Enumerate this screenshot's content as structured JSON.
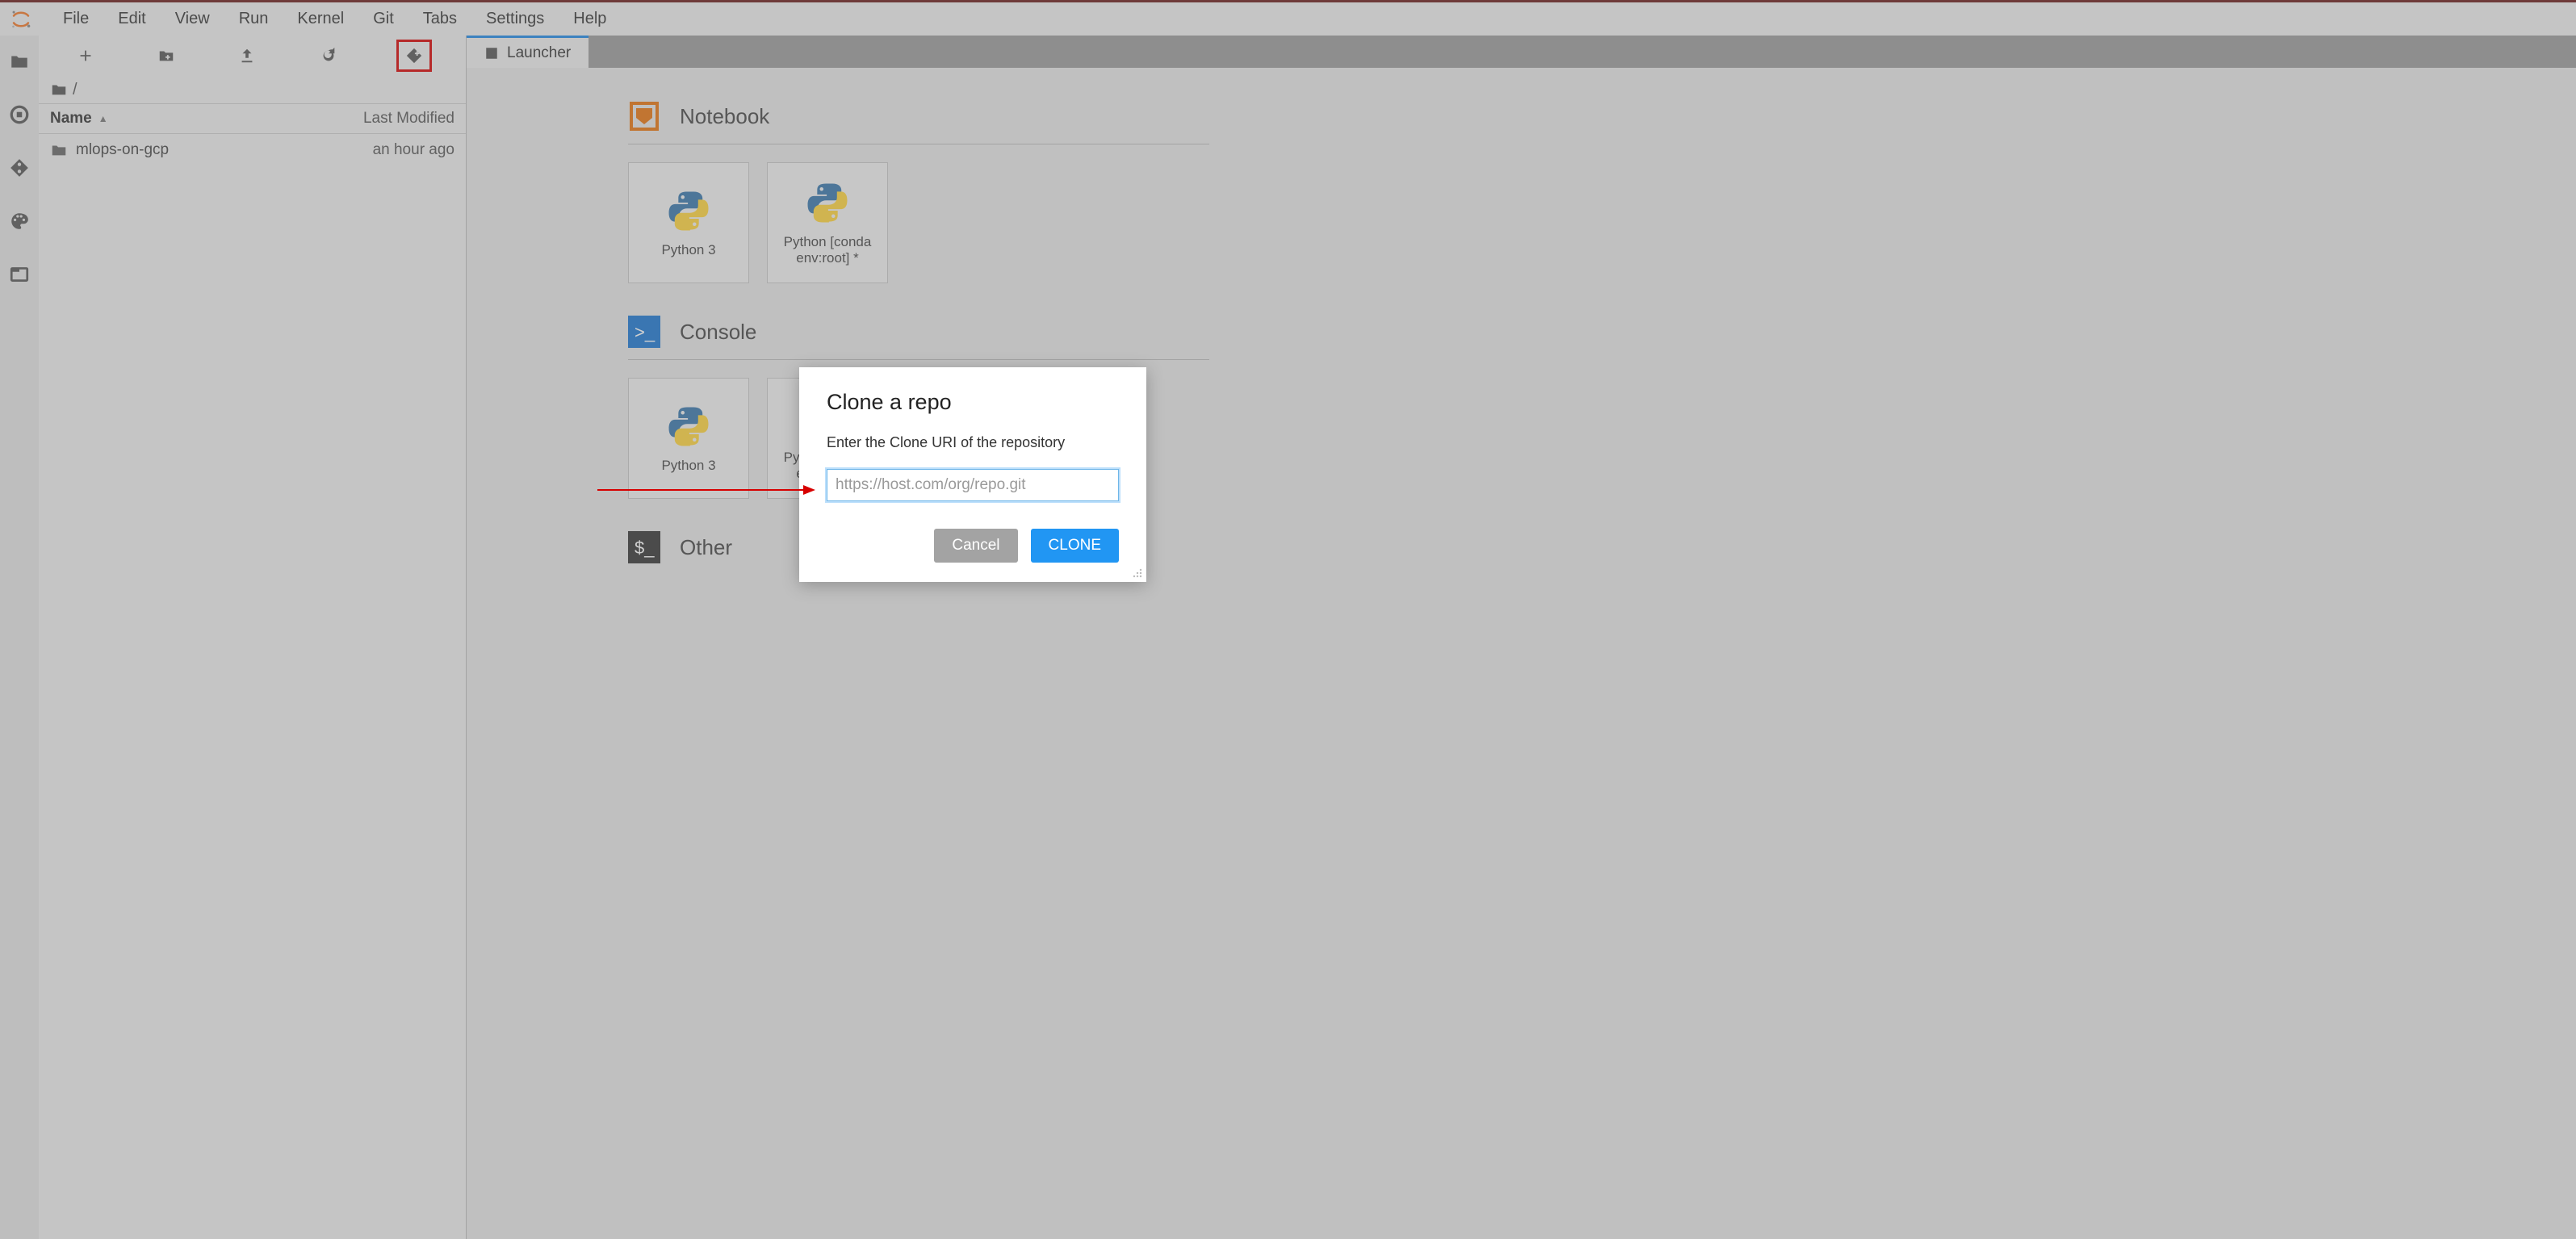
{
  "menu": {
    "items": [
      "File",
      "Edit",
      "View",
      "Run",
      "Kernel",
      "Git",
      "Tabs",
      "Settings",
      "Help"
    ]
  },
  "filebrowser": {
    "breadcrumb_root": "/",
    "columns": {
      "name": "Name",
      "modified": "Last Modified"
    },
    "rows": [
      {
        "name": "mlops-on-gcp",
        "modified": "an hour ago"
      }
    ]
  },
  "tab": {
    "label": "Launcher"
  },
  "launcher": {
    "sections": [
      {
        "title": "Notebook",
        "cards": [
          {
            "label": "Python 3"
          },
          {
            "label": "Python [conda env:root] *"
          }
        ]
      },
      {
        "title": "Console",
        "cards": [
          {
            "label": "Python 3"
          },
          {
            "label": "Python [conda env:root] *"
          }
        ]
      },
      {
        "title": "Other",
        "cards": []
      }
    ]
  },
  "dialog": {
    "title": "Clone a repo",
    "subtitle": "Enter the Clone URI of the repository",
    "placeholder": "https://host.com/org/repo.git",
    "cancel": "Cancel",
    "clone": "CLONE"
  }
}
